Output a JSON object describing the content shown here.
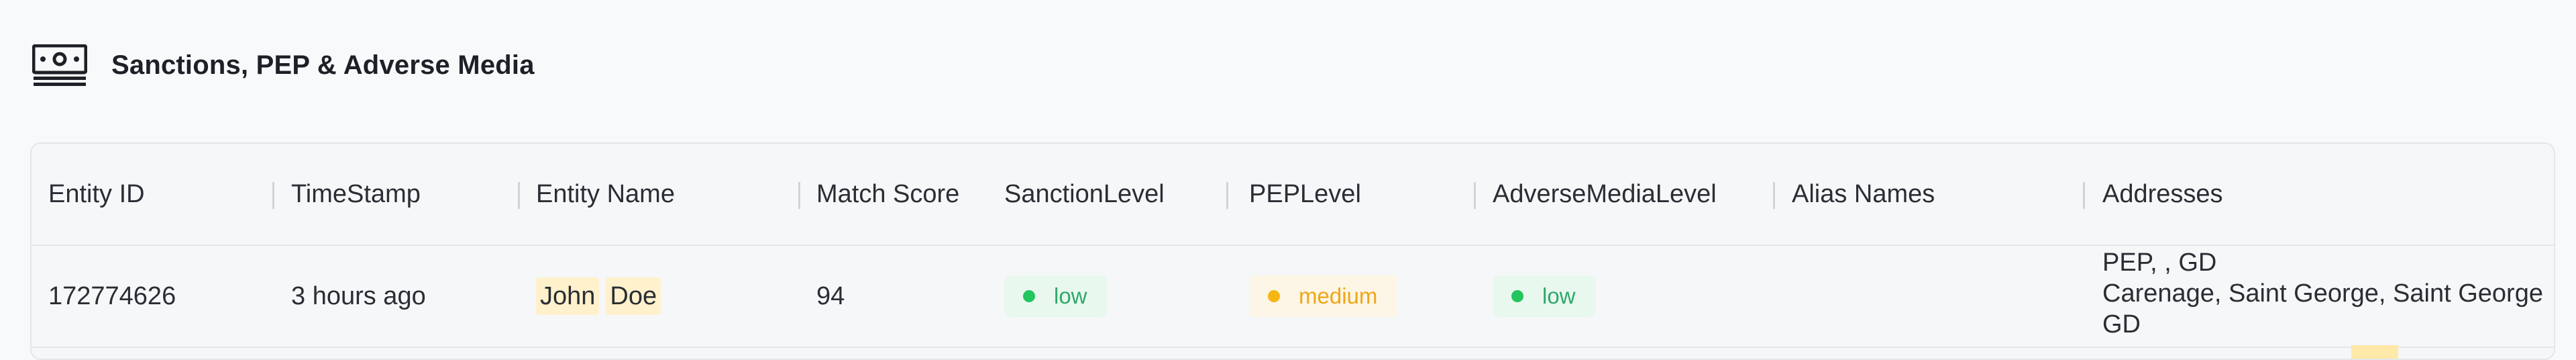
{
  "section": {
    "title": "Sanctions, PEP & Adverse Media",
    "icon": "banknote-icon"
  },
  "table": {
    "columns": [
      "Entity ID",
      "TimeStamp",
      "Entity Name",
      "Match Score",
      "SanctionLevel",
      "PEPLevel",
      "AdverseMediaLevel",
      "Alias Names",
      "Addresses"
    ],
    "rows": [
      {
        "entity_id": "172774626",
        "timestamp": "3 hours ago",
        "entity_name": [
          "John",
          "Doe"
        ],
        "match_score": "94",
        "sanction_level": "low",
        "pep_level": "medium",
        "adverse_media_level": "low",
        "alias_names": "",
        "addresses": [
          "PEP, , GD",
          "Carenage, Saint George, Saint George",
          "GD"
        ]
      }
    ]
  },
  "colors": {
    "low": "#22c55e",
    "medium": "#f5b715",
    "highlight": "#fff1cc"
  }
}
